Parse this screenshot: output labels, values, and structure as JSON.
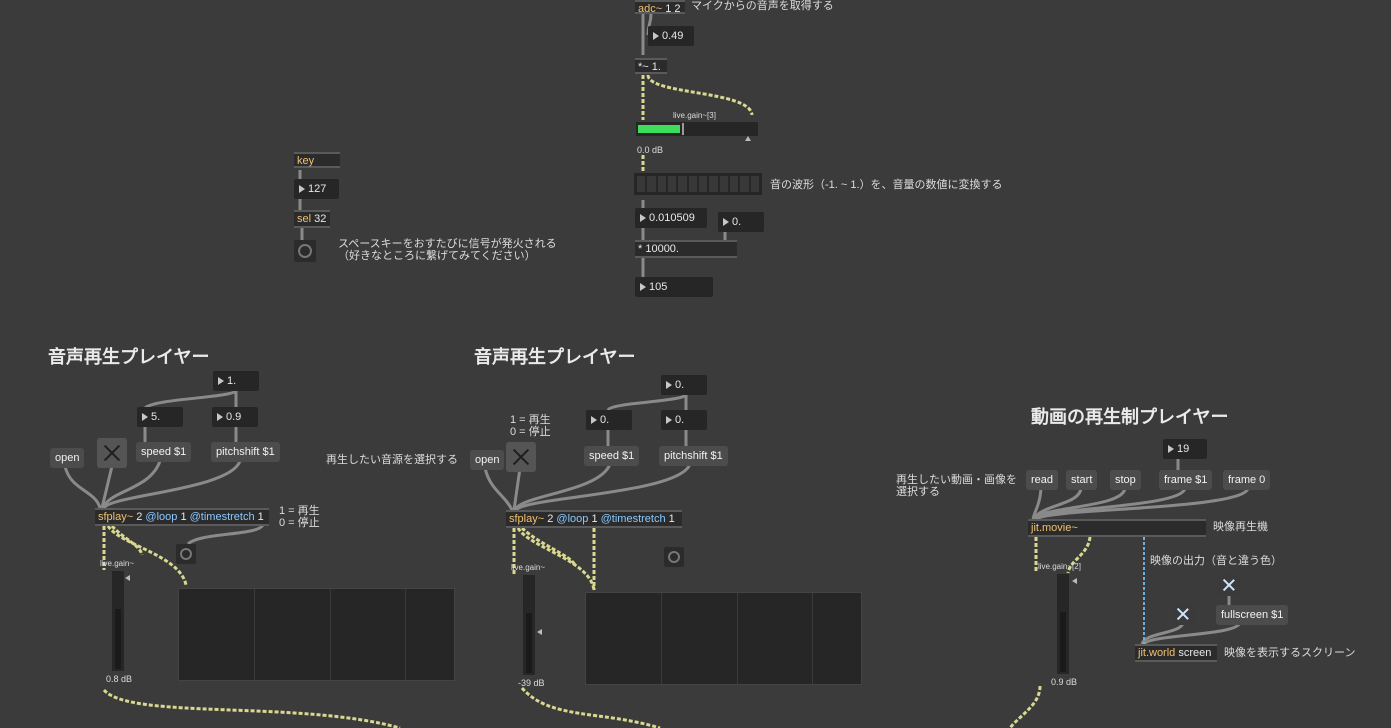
{
  "top_section": {
    "adc": {
      "kw": "adc~",
      "args": "1 2"
    },
    "adc_comment": "マイクからの音声を取得する",
    "gain_number": "0.49",
    "mul_object": "*~ 1.",
    "live_gain_label": "live.gain~[3]",
    "live_gain_db": "0.0 dB",
    "meter_comment": "音の波形（-1. ~ 1.）を、音量の数値に変換する",
    "meter_value": "0.010509",
    "meter_right_number": "0.",
    "mul_10000": "* 10000.",
    "result_number": "105",
    "meter_fill": 0.36
  },
  "key_section": {
    "key_object": "key",
    "key_number": "127",
    "sel": {
      "kw": "sel",
      "args": "32"
    },
    "comment": "スペースキーをおすたびに信号が発火される\n（好きなところに繋げてみてください）"
  },
  "player1": {
    "title": "音声再生プレイヤー",
    "num_top": "1.",
    "num_speed": "5.",
    "num_pitch": "0.9",
    "open_label": "open",
    "speed_label": "speed $1",
    "pitch_label": "pitchshift $1",
    "sfplay": {
      "kw": "sfplay~",
      "arg1": "2",
      "attr1": "@loop",
      "arg2": "1",
      "attr2": "@timestretch",
      "arg3": "1"
    },
    "play_comment": "1 = 再生\n0 = 停止",
    "gain_label": "live.gain~",
    "gain_db": "0.8 dB",
    "gain_level": 0.62
  },
  "player2": {
    "title": "音声再生プレイヤー",
    "select_comment": "再生したい音源を選択する",
    "play_comment": "1 = 再生\n0 = 停止",
    "num_top": "0.",
    "num_speed": "0.",
    "num_pitch": "0.",
    "open_label": "open",
    "speed_label": "speed $1",
    "pitch_label": "pitchshift $1",
    "sfplay": {
      "kw": "sfplay~",
      "arg1": "2",
      "attr1": "@loop",
      "arg2": "1",
      "attr2": "@timestretch",
      "arg3": "1"
    },
    "gain_label": "live.gain~",
    "gain_db": "-39 dB",
    "gain_level": 0.62
  },
  "video": {
    "title": "動画の再生制プレイヤー",
    "select_comment": "再生したい動画・画像を\n選択する",
    "frame_number": "19",
    "read_label": "read",
    "start_label": "start",
    "stop_label": "stop",
    "frame_label": "frame $1",
    "frame0_label": "frame 0",
    "movie_object": "jit.movie~",
    "movie_comment": "映像再生機",
    "output_comment": "映像の出力（音と違う色）",
    "gain_label": "live.gain~[2]",
    "gain_db": "0.9 dB",
    "gain_level": 0.62,
    "fullscreen_label": "fullscreen $1",
    "world": {
      "kw": "jit.world",
      "args": "screen"
    },
    "world_comment": "映像を表示するスクリーン"
  },
  "colors": {
    "background": "#3b3b3b",
    "signal_cable": "#d8d890",
    "control_cable": "#8a8a8a",
    "video_cable": "#6ab0e0",
    "meter_green": "#3ddc5a"
  }
}
